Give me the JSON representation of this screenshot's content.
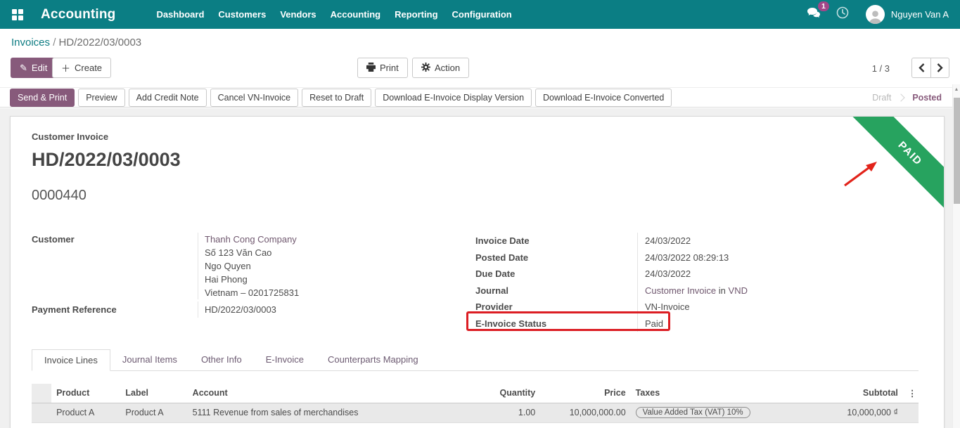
{
  "navbar": {
    "brand": "Accounting",
    "menus": [
      "Dashboard",
      "Customers",
      "Vendors",
      "Accounting",
      "Reporting",
      "Configuration"
    ],
    "badge_count": "1",
    "user_name": "Nguyen Van A"
  },
  "breadcrumb": {
    "parent": "Invoices",
    "separator": "/",
    "current": "HD/2022/03/0003"
  },
  "actions": {
    "edit": "Edit",
    "create": "Create",
    "print": "Print",
    "action": "Action",
    "pager": "1 / 3"
  },
  "statusbar": {
    "buttons": [
      "Send & Print",
      "Preview",
      "Add Credit Note",
      "Cancel VN-Invoice",
      "Reset to Draft",
      "Download E-Invoice Display Version",
      "Download E-Invoice Converted"
    ],
    "draft": "Draft",
    "posted": "Posted"
  },
  "document": {
    "type_label": "Customer Invoice",
    "name": "HD/2022/03/0003",
    "number": "0000440",
    "ribbon": "PAID"
  },
  "fields": {
    "customer": {
      "label": "Customer",
      "name": "Thanh Cong Company",
      "address_lines": [
        "Số 123 Văn Cao",
        "Ngo Quyen",
        "Hai Phong",
        "Vietnam – 0201725831"
      ]
    },
    "payment_reference": {
      "label": "Payment Reference",
      "value": "HD/2022/03/0003"
    },
    "invoice_date": {
      "label": "Invoice Date",
      "value": "24/03/2022"
    },
    "posted_date": {
      "label": "Posted Date",
      "value": "24/03/2022 08:29:13"
    },
    "due_date": {
      "label": "Due Date",
      "value": "24/03/2022"
    },
    "journal": {
      "label": "Journal",
      "value": "Customer Invoice",
      "in_word": "in",
      "currency": "VND"
    },
    "provider": {
      "label": "Provider",
      "value": "VN-Invoice"
    },
    "einvoice_status": {
      "label": "E-Invoice Status",
      "value": "Paid"
    }
  },
  "tabs": [
    {
      "label": "Invoice Lines"
    },
    {
      "label": "Journal Items"
    },
    {
      "label": "Other Info"
    },
    {
      "label": "E-Invoice"
    },
    {
      "label": "Counterparts Mapping"
    }
  ],
  "lines_table": {
    "headers": {
      "product": "Product",
      "label": "Label",
      "account": "Account",
      "quantity": "Quantity",
      "price": "Price",
      "taxes": "Taxes",
      "subtotal": "Subtotal"
    },
    "rows": [
      {
        "product": "Product A",
        "label": "Product A",
        "account": "5111 Revenue from sales of merchandises",
        "quantity": "1.00",
        "price": "10,000,000.00",
        "taxes": "Value Added Tax (VAT) 10%",
        "subtotal": "10,000,000 ₫"
      }
    ]
  },
  "colors": {
    "navbar_teal": "#0b7e84",
    "primary_purple": "#875a7b",
    "ribbon_green": "#27a35f",
    "annotation_red": "#dc1d23"
  }
}
